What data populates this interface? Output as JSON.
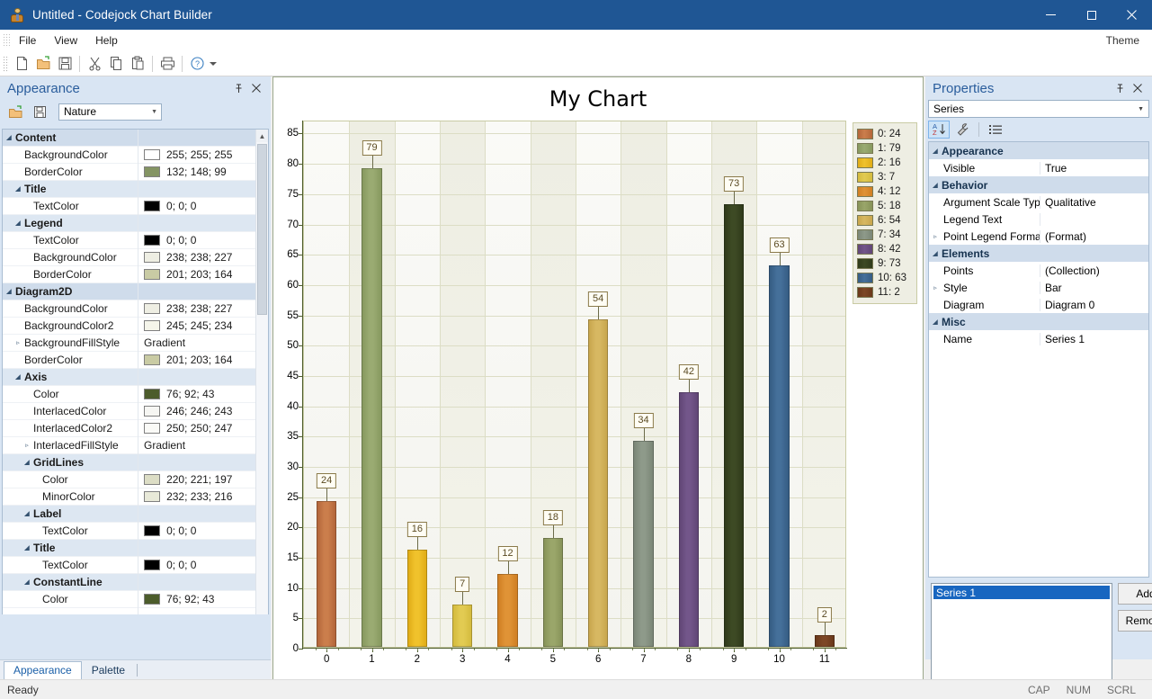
{
  "window": {
    "title": "Untitled -  Codejock Chart Builder",
    "app_icon": "person-icon",
    "minimize": "minimize-icon",
    "maximize": "maximize-icon",
    "close": "close-icon"
  },
  "menubar": {
    "items": [
      "File",
      "View",
      "Help"
    ],
    "theme_label": "Theme"
  },
  "toolbar": {
    "buttons": [
      "new-icon",
      "open-icon",
      "save-icon",
      "cut-icon",
      "copy-icon",
      "paste-icon",
      "print-icon",
      "help-icon",
      "dropdown-icon"
    ]
  },
  "appearance_panel": {
    "title": "Appearance",
    "pin": "pin-icon",
    "close": "close-icon",
    "toolbar": [
      "open-icon",
      "save-icon"
    ],
    "preset": "Nature",
    "rows": [
      {
        "level": 0,
        "type": "cat",
        "twist": "◢",
        "name": "Content"
      },
      {
        "level": 1,
        "type": "prop",
        "name": "BackgroundColor",
        "swatch": "#ffffff",
        "value": "255; 255; 255"
      },
      {
        "level": 1,
        "type": "prop",
        "name": "BorderColor",
        "swatch": "#849463",
        "value": "132; 148; 99"
      },
      {
        "level": 1,
        "type": "cat",
        "twist": "◢",
        "name": "Title"
      },
      {
        "level": 2,
        "type": "prop",
        "name": "TextColor",
        "swatch": "#000000",
        "value": "0; 0; 0"
      },
      {
        "level": 1,
        "type": "cat",
        "twist": "◢",
        "name": "Legend"
      },
      {
        "level": 2,
        "type": "prop",
        "name": "TextColor",
        "swatch": "#000000",
        "value": "0; 0; 0"
      },
      {
        "level": 2,
        "type": "prop",
        "name": "BackgroundColor",
        "swatch": "#eeeee3",
        "value": "238; 238; 227"
      },
      {
        "level": 2,
        "type": "prop",
        "name": "BorderColor",
        "swatch": "#c9cba4",
        "value": "201; 203; 164"
      },
      {
        "level": 0,
        "type": "cat",
        "twist": "◢",
        "name": "Diagram2D"
      },
      {
        "level": 1,
        "type": "prop",
        "name": "BackgroundColor",
        "swatch": "#eeeee3",
        "value": "238; 238; 227"
      },
      {
        "level": 1,
        "type": "prop",
        "name": "BackgroundColor2",
        "swatch": "#f5f5ea",
        "value": "245; 245; 234"
      },
      {
        "level": 1,
        "type": "prop",
        "twist": "▹",
        "name": "BackgroundFillStyle",
        "value": "Gradient"
      },
      {
        "level": 1,
        "type": "prop",
        "name": "BorderColor",
        "swatch": "#c9cba4",
        "value": "201; 203; 164"
      },
      {
        "level": 1,
        "type": "cat",
        "twist": "◢",
        "name": "Axis"
      },
      {
        "level": 2,
        "type": "prop",
        "name": "Color",
        "swatch": "#4c5c2b",
        "value": "76; 92; 43"
      },
      {
        "level": 2,
        "type": "prop",
        "name": "InterlacedColor",
        "swatch": "#f6f6f3",
        "value": "246; 246; 243"
      },
      {
        "level": 2,
        "type": "prop",
        "name": "InterlacedColor2",
        "swatch": "#fafaf7",
        "value": "250; 250; 247"
      },
      {
        "level": 2,
        "type": "prop",
        "twist": "▹",
        "name": "InterlacedFillStyle",
        "value": "Gradient"
      },
      {
        "level": 2,
        "type": "cat",
        "twist": "◢",
        "name": "GridLines"
      },
      {
        "level": 3,
        "type": "prop",
        "name": "Color",
        "swatch": "#dcddc5",
        "value": "220; 221; 197"
      },
      {
        "level": 3,
        "type": "prop",
        "name": "MinorColor",
        "swatch": "#e8e9d8",
        "value": "232; 233; 216"
      },
      {
        "level": 2,
        "type": "cat",
        "twist": "◢",
        "name": "Label"
      },
      {
        "level": 3,
        "type": "prop",
        "name": "TextColor",
        "swatch": "#000000",
        "value": "0; 0; 0"
      },
      {
        "level": 2,
        "type": "cat",
        "twist": "◢",
        "name": "Title"
      },
      {
        "level": 3,
        "type": "prop",
        "name": "TextColor",
        "swatch": "#000000",
        "value": "0; 0; 0"
      },
      {
        "level": 2,
        "type": "cat",
        "twist": "◢",
        "name": "ConstantLine"
      },
      {
        "level": 3,
        "type": "prop",
        "name": "Color",
        "swatch": "#4c5c2b",
        "value": "76; 92; 43"
      }
    ],
    "tabs": [
      {
        "label": "Appearance",
        "active": true
      },
      {
        "label": "Palette",
        "active": false
      }
    ]
  },
  "properties_panel": {
    "title": "Properties",
    "pin": "pin-icon",
    "close": "close-icon",
    "selector": "Series",
    "toolbar": [
      "sort-alpha-icon",
      "wrench-icon",
      "list-icon"
    ],
    "rows": [
      {
        "type": "cat",
        "twist": "◢",
        "name": "Appearance"
      },
      {
        "type": "prop",
        "name": "Visible",
        "value": "True"
      },
      {
        "type": "cat",
        "twist": "◢",
        "name": "Behavior"
      },
      {
        "type": "prop",
        "name": "Argument Scale Type",
        "value": "Qualitative"
      },
      {
        "type": "prop",
        "name": "Legend Text",
        "value": ""
      },
      {
        "type": "prop",
        "twist": "▹",
        "name": "Point Legend Format",
        "value": "(Format)"
      },
      {
        "type": "cat",
        "twist": "◢",
        "name": "Elements"
      },
      {
        "type": "prop",
        "name": "Points",
        "value": "(Collection)"
      },
      {
        "type": "prop",
        "twist": "▹",
        "name": "Style",
        "value": "Bar"
      },
      {
        "type": "prop",
        "name": "Diagram",
        "value": "Diagram 0"
      },
      {
        "type": "cat",
        "twist": "◢",
        "name": "Misc"
      },
      {
        "type": "prop",
        "name": "Name",
        "value": "Series 1"
      }
    ],
    "series_list": [
      "Series 1"
    ],
    "add_button": "Add",
    "remove_button": "Remove"
  },
  "statusbar": {
    "message": "Ready",
    "indicators": [
      "CAP",
      "NUM",
      "SCRL"
    ]
  },
  "chart_data": {
    "type": "bar",
    "title": "My Chart",
    "xlabel": "",
    "ylabel": "",
    "categories": [
      "0",
      "1",
      "2",
      "3",
      "4",
      "5",
      "6",
      "7",
      "8",
      "9",
      "10",
      "11"
    ],
    "values": [
      24,
      79,
      16,
      7,
      12,
      18,
      54,
      34,
      42,
      73,
      63,
      2
    ],
    "point_labels": [
      "24",
      "79",
      "16",
      "7",
      "12",
      "18",
      "54",
      "34",
      "42",
      "73",
      "63",
      "2"
    ],
    "ylim": [
      0,
      87
    ],
    "yticks": [
      0,
      5,
      10,
      15,
      20,
      25,
      30,
      35,
      40,
      45,
      50,
      55,
      60,
      65,
      70,
      75,
      80,
      85
    ],
    "grid": true,
    "legend_position": "right",
    "legend": [
      {
        "label": "0: 24",
        "color": "#cb7e4c",
        "color2": "#b3663a"
      },
      {
        "label": "1: 79",
        "color": "#9aab72",
        "color2": "#87995f"
      },
      {
        "label": "2: 16",
        "color": "#f0c22c",
        "color2": "#e0ac17"
      },
      {
        "label": "3: 7",
        "color": "#e2cb52",
        "color2": "#d4bb3e"
      },
      {
        "label": "4: 12",
        "color": "#e09336",
        "color2": "#d07f23"
      },
      {
        "label": "5: 18",
        "color": "#9aa66a",
        "color2": "#879358"
      },
      {
        "label": "6: 54",
        "color": "#d7b862",
        "color2": "#c8a64d"
      },
      {
        "label": "7: 34",
        "color": "#8e9a8a",
        "color2": "#7b8677"
      },
      {
        "label": "8: 42",
        "color": "#73568a",
        "color2": "#614676"
      },
      {
        "label": "9: 73",
        "color": "#3d4a24",
        "color2": "#2f3a1a"
      },
      {
        "label": "10: 63",
        "color": "#45709a",
        "color2": "#355c83"
      },
      {
        "label": "11: 2",
        "color": "#7d4726",
        "color2": "#69381a"
      }
    ]
  }
}
